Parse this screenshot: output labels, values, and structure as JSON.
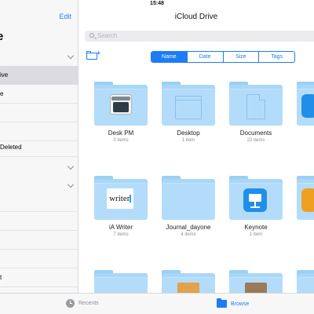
{
  "status_bar": {
    "time": "15:48"
  },
  "sidebar": {
    "edit_label": "Edit",
    "title": "e",
    "items": [
      {
        "label": "ive",
        "selected": true
      },
      {
        "label": "e"
      },
      {
        "label": ""
      },
      {
        "label": ""
      },
      {
        "label": " Deleted"
      },
      {
        "label": ""
      },
      {
        "label": ""
      },
      {
        "label": ""
      },
      {
        "label": ""
      },
      {
        "label": ""
      },
      {
        "label": "t"
      }
    ]
  },
  "main": {
    "title": "iCloud Drive",
    "search_placeholder": "Search",
    "new_folder_icon": "new-folder-icon",
    "sort_tabs": [
      {
        "label": "Name",
        "active": true
      },
      {
        "label": "Date"
      },
      {
        "label": "Size"
      },
      {
        "label": "Tags"
      }
    ],
    "folders": [
      {
        "name": "Desk PM",
        "count": "0 items",
        "icon": "typewriter-icon"
      },
      {
        "name": "Desktop",
        "count": "1 item",
        "icon": "window-icon"
      },
      {
        "name": "Documents",
        "count": "22 items",
        "icon": "document-icon"
      },
      {
        "name": "",
        "count": "",
        "icon": "app-icon"
      },
      {
        "name": "iA Writer",
        "count": "7 items",
        "icon": "writer-icon",
        "icon_text": "writer"
      },
      {
        "name": "Journal_dayone",
        "count": "4 items",
        "icon": ""
      },
      {
        "name": "Keynote",
        "count": "1 item",
        "icon": "keynote-icon"
      },
      {
        "name": "",
        "count": "",
        "icon": "app-icon"
      },
      {
        "name": "",
        "count": "",
        "icon": ""
      },
      {
        "name": "",
        "count": "",
        "icon": "photo-icon"
      },
      {
        "name": "",
        "count": "",
        "icon": "photo-icon"
      },
      {
        "name": "",
        "count": "",
        "icon": ""
      }
    ]
  },
  "tab_bar": {
    "recents_label": "Recents",
    "browse_label": "Browse"
  },
  "colors": {
    "accent": "#1d7cf6",
    "folder": "#b3dcfa"
  }
}
